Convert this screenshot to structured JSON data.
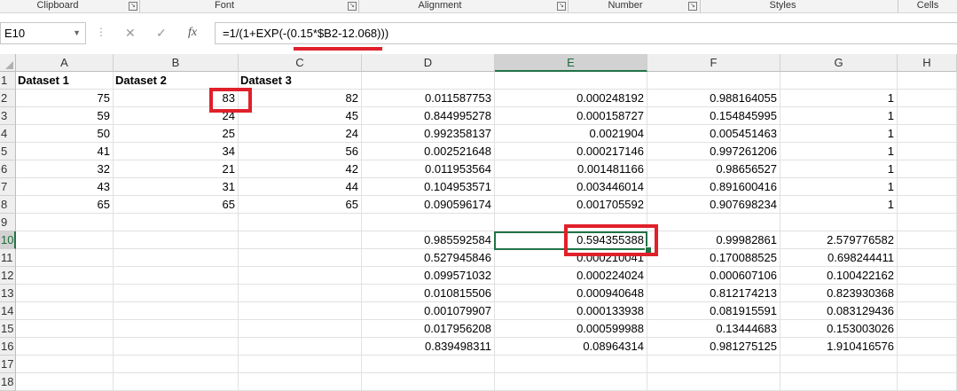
{
  "ribbon": {
    "groups": [
      "Clipboard",
      "Font",
      "Alignment",
      "Number",
      "Styles",
      "Cells"
    ]
  },
  "formula_bar": {
    "name_box": "E10",
    "cancel_glyph": "✕",
    "enter_glyph": "✓",
    "fx_label": "fx",
    "formula": "=1/(1+EXP(-(0.15*$B2-12.068)))"
  },
  "columns": [
    "A",
    "B",
    "C",
    "D",
    "E",
    "F",
    "G",
    "H"
  ],
  "rows": [
    "1",
    "2",
    "3",
    "4",
    "5",
    "6",
    "7",
    "8",
    "9",
    "10",
    "11",
    "12",
    "13",
    "14",
    "15",
    "16",
    "17",
    "18"
  ],
  "selection": {
    "cell": "E10",
    "column": "E",
    "row": "10"
  },
  "highlight_color": "#e0202a",
  "accent_color": "#217346",
  "sheet": {
    "r1": {
      "A": "Dataset 1",
      "B": "Dataset 2",
      "C": "Dataset 3"
    },
    "r2": {
      "A": "75",
      "B": "83",
      "C": "82",
      "D": "0.011587753",
      "E": "0.000248192",
      "F": "0.988164055",
      "G": "1"
    },
    "r3": {
      "A": "59",
      "B": "24",
      "C": "45",
      "D": "0.844995278",
      "E": "0.000158727",
      "F": "0.154845995",
      "G": "1"
    },
    "r4": {
      "A": "50",
      "B": "25",
      "C": "24",
      "D": "0.992358137",
      "E": "0.0021904",
      "F": "0.005451463",
      "G": "1"
    },
    "r5": {
      "A": "41",
      "B": "34",
      "C": "56",
      "D": "0.002521648",
      "E": "0.000217146",
      "F": "0.997261206",
      "G": "1"
    },
    "r6": {
      "A": "32",
      "B": "21",
      "C": "42",
      "D": "0.011953564",
      "E": "0.001481166",
      "F": "0.98656527",
      "G": "1"
    },
    "r7": {
      "A": "43",
      "B": "31",
      "C": "44",
      "D": "0.104953571",
      "E": "0.003446014",
      "F": "0.891600416",
      "G": "1"
    },
    "r8": {
      "A": "65",
      "B": "65",
      "C": "65",
      "D": "0.090596174",
      "E": "0.001705592",
      "F": "0.907698234",
      "G": "1"
    },
    "r10": {
      "D": "0.985592584",
      "E": "0.594355388",
      "F": "0.99982861",
      "G": "2.579776582"
    },
    "r11": {
      "D": "0.527945846",
      "E": "0.000210041",
      "F": "0.170088525",
      "G": "0.698244411"
    },
    "r12": {
      "D": "0.099571032",
      "E": "0.000224024",
      "F": "0.000607106",
      "G": "0.100422162"
    },
    "r13": {
      "D": "0.010815506",
      "E": "0.000940648",
      "F": "0.812174213",
      "G": "0.823930368"
    },
    "r14": {
      "D": "0.001079907",
      "E": "0.000133938",
      "F": "0.081915591",
      "G": "0.083129436"
    },
    "r15": {
      "D": "0.017956208",
      "E": "0.000599988",
      "F": "0.13444683",
      "G": "0.153003026"
    },
    "r16": {
      "D": "0.839498311",
      "E": "0.08964314",
      "F": "0.981275125",
      "G": "1.910416576"
    }
  }
}
